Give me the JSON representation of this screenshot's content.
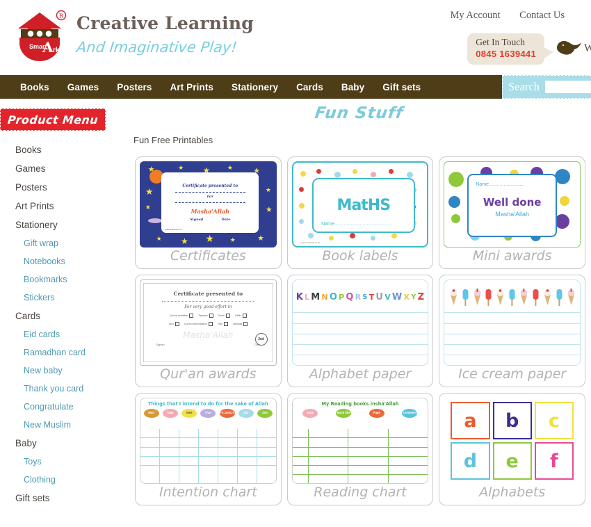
{
  "header": {
    "brand_title": "Creative Learning",
    "brand_tagline": "And Imaginative Play!",
    "logo_word_top": "Smart",
    "logo_word_bottom": "Ark",
    "logo_registered": "®",
    "top_links": [
      {
        "label": "My Account"
      },
      {
        "label": "Contact Us"
      }
    ],
    "get_in_touch_title": "Get In Touch",
    "get_in_touch_phone": "0845 1639441",
    "after_bird_text": "W"
  },
  "nav": {
    "items": [
      {
        "label": "Books"
      },
      {
        "label": "Games"
      },
      {
        "label": "Posters"
      },
      {
        "label": "Art Prints"
      },
      {
        "label": "Stationery"
      },
      {
        "label": "Cards"
      },
      {
        "label": "Baby"
      },
      {
        "label": "Gift sets"
      }
    ],
    "search_label": "Search",
    "search_value": "",
    "search_placeholder": ""
  },
  "sidebar": {
    "banner_title": "Product Menu",
    "items": [
      {
        "label": "Books",
        "level": "top"
      },
      {
        "label": "Games",
        "level": "top"
      },
      {
        "label": "Posters",
        "level": "top"
      },
      {
        "label": "Art Prints",
        "level": "top"
      },
      {
        "label": "Stationery",
        "level": "top"
      },
      {
        "label": "Gift wrap",
        "level": "sub"
      },
      {
        "label": "Notebooks",
        "level": "sub"
      },
      {
        "label": "Bookmarks",
        "level": "sub"
      },
      {
        "label": "Stickers",
        "level": "sub"
      },
      {
        "label": "Cards",
        "level": "top"
      },
      {
        "label": "Eid cards",
        "level": "sub"
      },
      {
        "label": "Ramadhan card",
        "level": "sub"
      },
      {
        "label": "New baby",
        "level": "sub"
      },
      {
        "label": "Thank you card",
        "level": "sub"
      },
      {
        "label": "Congratulate",
        "level": "sub"
      },
      {
        "label": "New Muslim",
        "level": "sub"
      },
      {
        "label": "Baby",
        "level": "top"
      },
      {
        "label": "Toys",
        "level": "sub"
      },
      {
        "label": "Clothing",
        "level": "sub"
      },
      {
        "label": "Gift sets",
        "level": "top"
      }
    ]
  },
  "main": {
    "page_title": "Fun Stuff",
    "subheading": "Fun Free Printables",
    "cards": [
      {
        "caption": "Certificates",
        "art": "certificate",
        "text": {
          "line1": "Certificate presented to",
          "line2": "For",
          "line3": "Masha'Allah",
          "signed": "Signed",
          "date": "Date",
          "url": "www.smartark.co.uk"
        }
      },
      {
        "caption": "Book labels",
        "art": "book-label",
        "text": {
          "subject": "MatHS",
          "name": "Name..........................................",
          "url": "www.smartark.co.uk"
        }
      },
      {
        "caption": "Mini awards",
        "art": "mini-award",
        "text": {
          "name": "Name..........................",
          "headline": "Well done",
          "sub": "Masha'Allah"
        }
      },
      {
        "caption": "Qur'an awards",
        "art": "quran-award",
        "text": {
          "title": "Certificate presented to",
          "effort": "For very good effort in",
          "checks_row1": [
            "Qur'an recitation",
            "Tajweed",
            "Surah",
            "Hifdh"
          ],
          "checks_row2": [
            "Du'a",
            "Qur'an memorisation",
            "Fiqh",
            "Akhlaaq"
          ],
          "watermark": "Masha'Allah",
          "seal": "2nd",
          "signed": "Signed",
          "date": "Date"
        }
      },
      {
        "caption": "Alphabet paper",
        "art": "alphabet-paper",
        "text": {
          "letters": [
            "K",
            "L",
            "M",
            "N",
            "O",
            "P",
            "Q",
            "R",
            "S",
            "T",
            "U",
            "V",
            "W",
            "X",
            "Y",
            "Z"
          ]
        }
      },
      {
        "caption": "Ice cream paper",
        "art": "icecream-paper",
        "text": {}
      },
      {
        "caption": "Intention chart",
        "art": "intention-chart",
        "text": {
          "title": "Things that I intend to do for the sake of Allah",
          "days": [
            "Mon",
            "Tues",
            "Wed",
            "Thur",
            "Fri Jumu'a",
            "Sat",
            "Sun"
          ]
        }
      },
      {
        "caption": "Reading chart",
        "art": "reading-chart",
        "text": {
          "title": "My Reading books insha'Allah",
          "columns": [
            "Date",
            "Book title",
            "Page",
            "Comment"
          ]
        }
      },
      {
        "caption": "Alphabets",
        "art": "alphabet-blocks",
        "text": {
          "letters": [
            "a",
            "b",
            "c",
            "d",
            "e",
            "f"
          ]
        }
      }
    ]
  },
  "colors": {
    "nav_bg": "#4e3d17",
    "brand_red": "#e3242b",
    "accent_blue": "#7ccbdd",
    "link_blue": "#4d9ab0",
    "caption_grey": "#b2b2b2",
    "search_bg": "#a9dde8",
    "phone_red": "#e63b2e"
  }
}
